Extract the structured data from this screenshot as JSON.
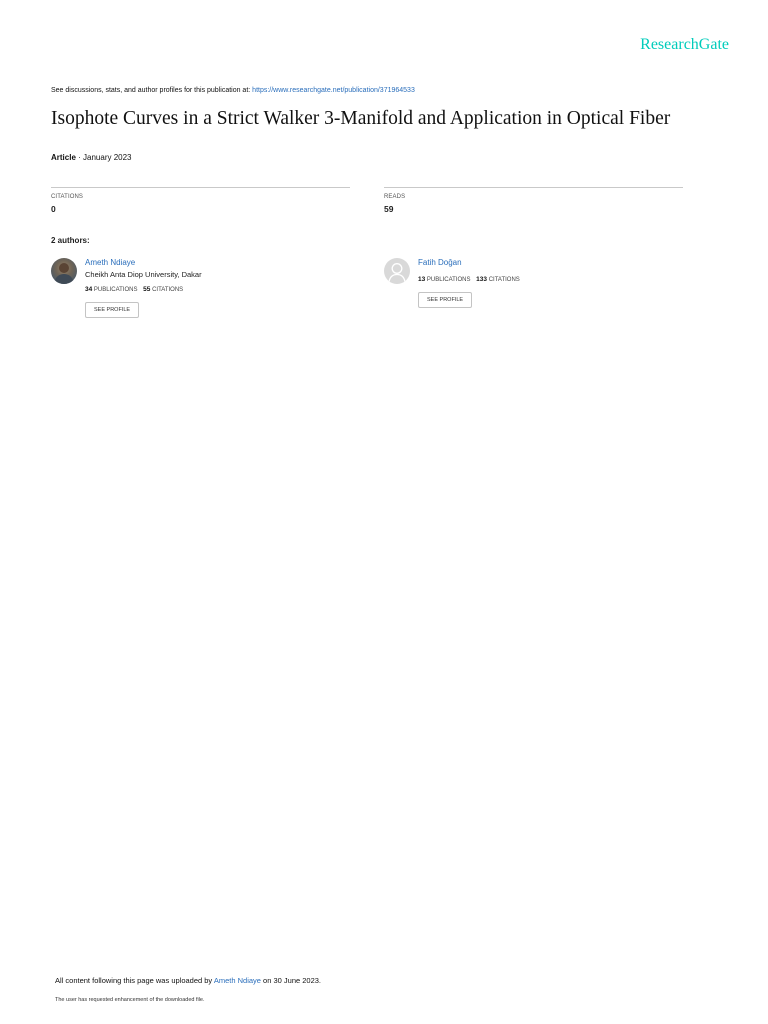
{
  "branding": {
    "logo_text": "ResearchGate",
    "logo_color": "#00ccbb"
  },
  "header": {
    "discussions_prefix": "See discussions, stats, and author profiles for this publication at: ",
    "publication_url": "https://www.researchgate.net/publication/371964533"
  },
  "publication": {
    "title": "Isophote Curves in a Strict Walker 3-Manifold and Application in Optical Fiber",
    "type": "Article",
    "date": "· January 2023"
  },
  "stats": {
    "citations_label": "CITATIONS",
    "citations_value": "0",
    "reads_label": "READS",
    "reads_value": "59"
  },
  "authors_heading": "2 authors:",
  "authors": [
    {
      "name": "Ameth Ndiaye",
      "institution": "Cheikh Anta Diop University, Dakar",
      "publications_count": "34",
      "publications_label": "PUBLICATIONS",
      "citations_count": "55",
      "citations_label": "CITATIONS",
      "button_label": "SEE PROFILE"
    },
    {
      "name": "Fatih Doğan",
      "institution": "",
      "publications_count": "13",
      "publications_label": "PUBLICATIONS",
      "citations_count": "133",
      "citations_label": "CITATIONS",
      "button_label": "SEE PROFILE"
    }
  ],
  "footer": {
    "upload_prefix": "All content following this page was uploaded by ",
    "uploader_name": "Ameth Ndiaye",
    "upload_suffix": " on 30 June 2023.",
    "enhancement_note": "The user has requested enhancement of the downloaded file."
  },
  "colors": {
    "link": "#2a6ebb",
    "text": "#111111",
    "divider": "#c9c9c9"
  }
}
